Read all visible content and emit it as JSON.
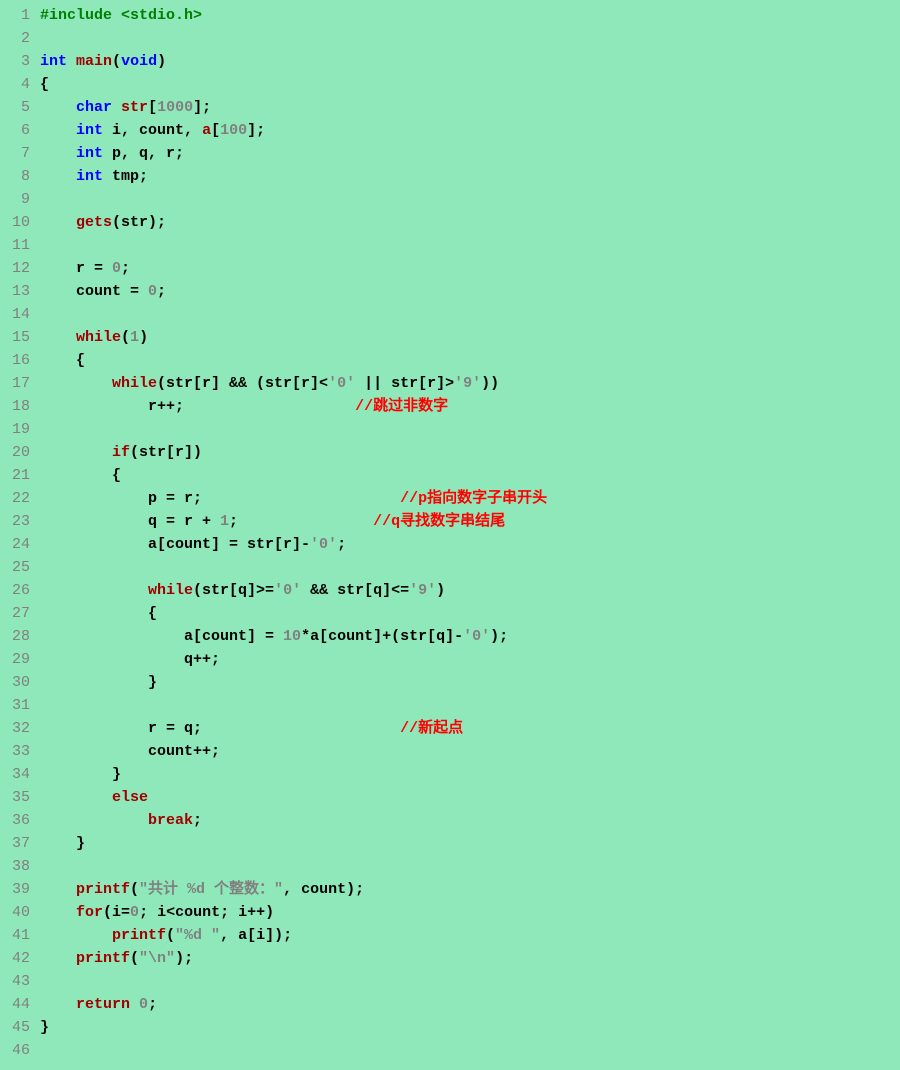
{
  "source_language": "C",
  "theme_colors": {
    "background": "#8fe8ba",
    "keyword": "#0000ff",
    "function": "#a00000",
    "number": "#808080",
    "string": "#808080",
    "comment": "#ff0000",
    "preprocessor": "#008000",
    "default": "#000000",
    "lineno": "#808080"
  },
  "lines": [
    {
      "n": 1,
      "tokens": [
        {
          "c": "pp",
          "t": "#include <stdio.h>"
        }
      ]
    },
    {
      "n": 2,
      "tokens": []
    },
    {
      "n": 3,
      "tokens": [
        {
          "c": "kw",
          "t": "int"
        },
        {
          "c": "id",
          "t": " "
        },
        {
          "c": "fn",
          "t": "main"
        },
        {
          "c": "pun",
          "t": "("
        },
        {
          "c": "kw",
          "t": "void"
        },
        {
          "c": "pun",
          "t": ")"
        }
      ]
    },
    {
      "n": 4,
      "tokens": [
        {
          "c": "pun",
          "t": "{"
        }
      ]
    },
    {
      "n": 5,
      "tokens": [
        {
          "c": "id",
          "t": "    "
        },
        {
          "c": "kw",
          "t": "char"
        },
        {
          "c": "id",
          "t": " "
        },
        {
          "c": "fn",
          "t": "str"
        },
        {
          "c": "pun",
          "t": "["
        },
        {
          "c": "num",
          "t": "1000"
        },
        {
          "c": "pun",
          "t": "];"
        }
      ]
    },
    {
      "n": 6,
      "tokens": [
        {
          "c": "id",
          "t": "    "
        },
        {
          "c": "kw",
          "t": "int"
        },
        {
          "c": "id",
          "t": " i, count, "
        },
        {
          "c": "fn",
          "t": "a"
        },
        {
          "c": "pun",
          "t": "["
        },
        {
          "c": "num",
          "t": "100"
        },
        {
          "c": "pun",
          "t": "];"
        }
      ]
    },
    {
      "n": 7,
      "tokens": [
        {
          "c": "id",
          "t": "    "
        },
        {
          "c": "kw",
          "t": "int"
        },
        {
          "c": "id",
          "t": " p, q, r;"
        }
      ]
    },
    {
      "n": 8,
      "tokens": [
        {
          "c": "id",
          "t": "    "
        },
        {
          "c": "kw",
          "t": "int"
        },
        {
          "c": "id",
          "t": " tmp;"
        }
      ]
    },
    {
      "n": 9,
      "tokens": []
    },
    {
      "n": 10,
      "tokens": [
        {
          "c": "id",
          "t": "    "
        },
        {
          "c": "fn",
          "t": "gets"
        },
        {
          "c": "pun",
          "t": "(str);"
        }
      ]
    },
    {
      "n": 11,
      "tokens": []
    },
    {
      "n": 12,
      "tokens": [
        {
          "c": "id",
          "t": "    r = "
        },
        {
          "c": "num",
          "t": "0"
        },
        {
          "c": "pun",
          "t": ";"
        }
      ]
    },
    {
      "n": 13,
      "tokens": [
        {
          "c": "id",
          "t": "    count = "
        },
        {
          "c": "num",
          "t": "0"
        },
        {
          "c": "pun",
          "t": ";"
        }
      ]
    },
    {
      "n": 14,
      "tokens": []
    },
    {
      "n": 15,
      "tokens": [
        {
          "c": "id",
          "t": "    "
        },
        {
          "c": "fn",
          "t": "while"
        },
        {
          "c": "pun",
          "t": "("
        },
        {
          "c": "num",
          "t": "1"
        },
        {
          "c": "pun",
          "t": ")"
        }
      ]
    },
    {
      "n": 16,
      "tokens": [
        {
          "c": "id",
          "t": "    {"
        }
      ]
    },
    {
      "n": 17,
      "tokens": [
        {
          "c": "id",
          "t": "        "
        },
        {
          "c": "fn",
          "t": "while"
        },
        {
          "c": "pun",
          "t": "(str[r] && (str[r]<"
        },
        {
          "c": "str",
          "t": "'0'"
        },
        {
          "c": "pun",
          "t": " || str[r]>"
        },
        {
          "c": "str",
          "t": "'9'"
        },
        {
          "c": "pun",
          "t": "))"
        }
      ]
    },
    {
      "n": 18,
      "tokens": [
        {
          "c": "id",
          "t": "            r++;                   "
        },
        {
          "c": "cmt",
          "t": "//跳过非数字"
        }
      ]
    },
    {
      "n": 19,
      "tokens": []
    },
    {
      "n": 20,
      "tokens": [
        {
          "c": "id",
          "t": "        "
        },
        {
          "c": "fn",
          "t": "if"
        },
        {
          "c": "pun",
          "t": "(str[r])"
        }
      ]
    },
    {
      "n": 21,
      "tokens": [
        {
          "c": "id",
          "t": "        {"
        }
      ]
    },
    {
      "n": 22,
      "tokens": [
        {
          "c": "id",
          "t": "            p = r;                      "
        },
        {
          "c": "cmt",
          "t": "//p指向数字子串开头"
        }
      ]
    },
    {
      "n": 23,
      "tokens": [
        {
          "c": "id",
          "t": "            q = r + "
        },
        {
          "c": "num",
          "t": "1"
        },
        {
          "c": "pun",
          "t": ";"
        },
        {
          "c": "id",
          "t": "               "
        },
        {
          "c": "cmt",
          "t": "//q寻找数字串结尾"
        }
      ]
    },
    {
      "n": 24,
      "tokens": [
        {
          "c": "id",
          "t": "            a[count] = str[r]-"
        },
        {
          "c": "str",
          "t": "'0'"
        },
        {
          "c": "pun",
          "t": ";"
        }
      ]
    },
    {
      "n": 25,
      "tokens": []
    },
    {
      "n": 26,
      "tokens": [
        {
          "c": "id",
          "t": "            "
        },
        {
          "c": "fn",
          "t": "while"
        },
        {
          "c": "pun",
          "t": "(str[q]>="
        },
        {
          "c": "str",
          "t": "'0'"
        },
        {
          "c": "pun",
          "t": " && str[q]<="
        },
        {
          "c": "str",
          "t": "'9'"
        },
        {
          "c": "pun",
          "t": ")"
        }
      ]
    },
    {
      "n": 27,
      "tokens": [
        {
          "c": "id",
          "t": "            {"
        }
      ]
    },
    {
      "n": 28,
      "tokens": [
        {
          "c": "id",
          "t": "                a[count] = "
        },
        {
          "c": "num",
          "t": "10"
        },
        {
          "c": "id",
          "t": "*a[count]+(str[q]-"
        },
        {
          "c": "str",
          "t": "'0'"
        },
        {
          "c": "pun",
          "t": ");"
        }
      ]
    },
    {
      "n": 29,
      "tokens": [
        {
          "c": "id",
          "t": "                q++;"
        }
      ]
    },
    {
      "n": 30,
      "tokens": [
        {
          "c": "id",
          "t": "            }"
        }
      ]
    },
    {
      "n": 31,
      "tokens": []
    },
    {
      "n": 32,
      "tokens": [
        {
          "c": "id",
          "t": "            r = q;                      "
        },
        {
          "c": "cmt",
          "t": "//新起点"
        }
      ]
    },
    {
      "n": 33,
      "tokens": [
        {
          "c": "id",
          "t": "            count++;"
        }
      ]
    },
    {
      "n": 34,
      "tokens": [
        {
          "c": "id",
          "t": "        }"
        }
      ]
    },
    {
      "n": 35,
      "tokens": [
        {
          "c": "id",
          "t": "        "
        },
        {
          "c": "fn",
          "t": "else"
        }
      ]
    },
    {
      "n": 36,
      "tokens": [
        {
          "c": "id",
          "t": "            "
        },
        {
          "c": "fn",
          "t": "break"
        },
        {
          "c": "pun",
          "t": ";"
        }
      ]
    },
    {
      "n": 37,
      "tokens": [
        {
          "c": "id",
          "t": "    }"
        }
      ]
    },
    {
      "n": 38,
      "tokens": []
    },
    {
      "n": 39,
      "tokens": [
        {
          "c": "id",
          "t": "    "
        },
        {
          "c": "fn",
          "t": "printf"
        },
        {
          "c": "pun",
          "t": "("
        },
        {
          "c": "str",
          "t": "\"共计 %d 个整数：\""
        },
        {
          "c": "pun",
          "t": ", count);"
        }
      ]
    },
    {
      "n": 40,
      "tokens": [
        {
          "c": "id",
          "t": "    "
        },
        {
          "c": "fn",
          "t": "for"
        },
        {
          "c": "pun",
          "t": "(i="
        },
        {
          "c": "num",
          "t": "0"
        },
        {
          "c": "pun",
          "t": "; i<count; i++)"
        }
      ]
    },
    {
      "n": 41,
      "tokens": [
        {
          "c": "id",
          "t": "        "
        },
        {
          "c": "fn",
          "t": "printf"
        },
        {
          "c": "pun",
          "t": "("
        },
        {
          "c": "str",
          "t": "\"%d \""
        },
        {
          "c": "pun",
          "t": ", a[i]);"
        }
      ]
    },
    {
      "n": 42,
      "tokens": [
        {
          "c": "id",
          "t": "    "
        },
        {
          "c": "fn",
          "t": "printf"
        },
        {
          "c": "pun",
          "t": "("
        },
        {
          "c": "str",
          "t": "\"\\n\""
        },
        {
          "c": "pun",
          "t": ");"
        }
      ]
    },
    {
      "n": 43,
      "tokens": []
    },
    {
      "n": 44,
      "tokens": [
        {
          "c": "id",
          "t": "    "
        },
        {
          "c": "fn",
          "t": "return"
        },
        {
          "c": "id",
          "t": " "
        },
        {
          "c": "num",
          "t": "0"
        },
        {
          "c": "pun",
          "t": ";"
        }
      ]
    },
    {
      "n": 45,
      "tokens": [
        {
          "c": "pun",
          "t": "}"
        }
      ]
    },
    {
      "n": 46,
      "tokens": []
    }
  ]
}
